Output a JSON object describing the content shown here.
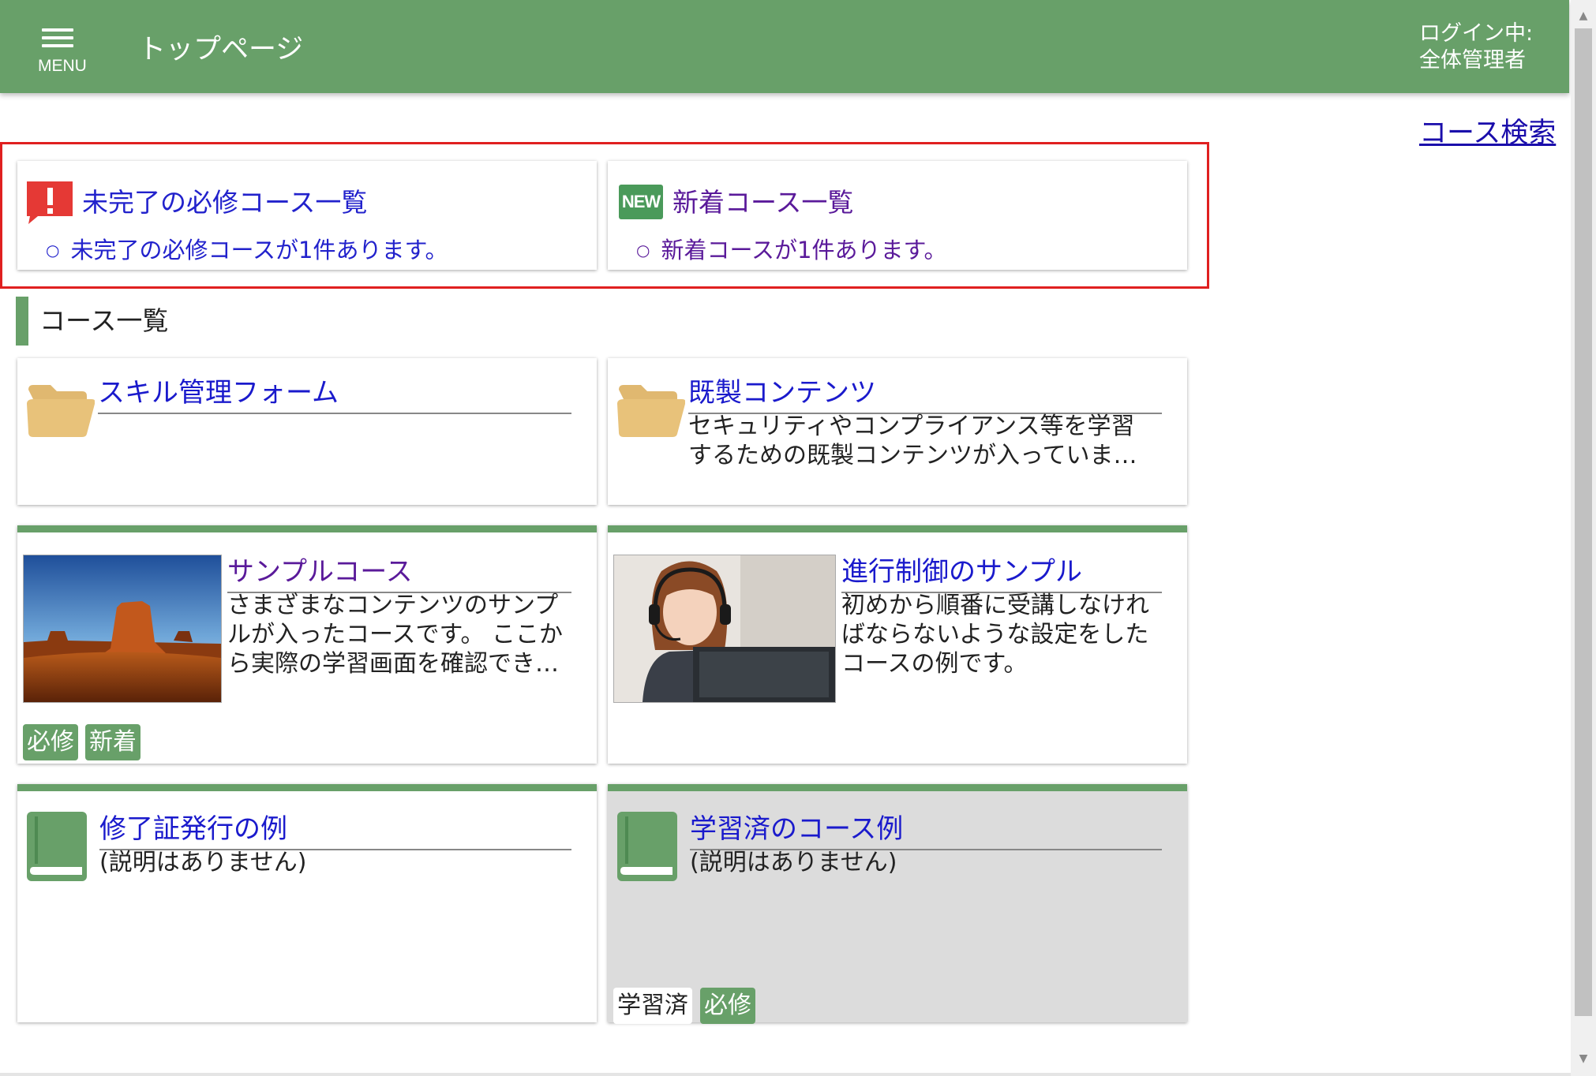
{
  "header": {
    "menu_label": "MENU",
    "page_title": "トップページ",
    "login_line1": "ログイン中:",
    "login_line2": "全体管理者"
  },
  "course_search": "コース検索",
  "notices": {
    "required": {
      "title": "未完了の必修コース一覧",
      "item": "未完了の必修コースが1件あります。",
      "icon": "alert-icon"
    },
    "new": {
      "title": "新着コース一覧",
      "item": "新着コースが1件あります。",
      "icon_label": "NEW",
      "icon": "new-icon"
    }
  },
  "section_title": "コース一覧",
  "courses": [
    {
      "title": "スキル管理フォーム",
      "desc": "",
      "icon": "folder-icon",
      "badges": []
    },
    {
      "title": "既製コンテンツ",
      "desc1": "セキュリティやコンプライアンス等を学習",
      "desc2": "するための既製コンテンツが入っていま…",
      "icon": "folder-icon",
      "badges": []
    },
    {
      "title": "サンプルコース",
      "desc1": "さまざまなコンテンツのサンプ",
      "desc2": "ルが入ったコースです。 ここか",
      "desc3": "ら実際の学習画面を確認でき…",
      "icon": "desert-thumbnail",
      "badges": [
        "必修",
        "新着"
      ]
    },
    {
      "title": "進行制御のサンプル",
      "desc1": "初めから順番に受講しなけれ",
      "desc2": "ばならないような設定をした",
      "desc3": "コースの例です。",
      "icon": "headset-woman-thumbnail",
      "badges": []
    },
    {
      "title": "修了証発行の例",
      "desc": "(説明はありません)",
      "icon": "book-icon",
      "badges": []
    },
    {
      "title": "学習済のコース例",
      "desc": "(説明はありません)",
      "icon": "book-icon",
      "badges": [
        "学習済",
        "必修"
      ]
    }
  ],
  "colors": {
    "header": "#68a069",
    "link": "#1a1acc",
    "highlight": "#e02020"
  }
}
